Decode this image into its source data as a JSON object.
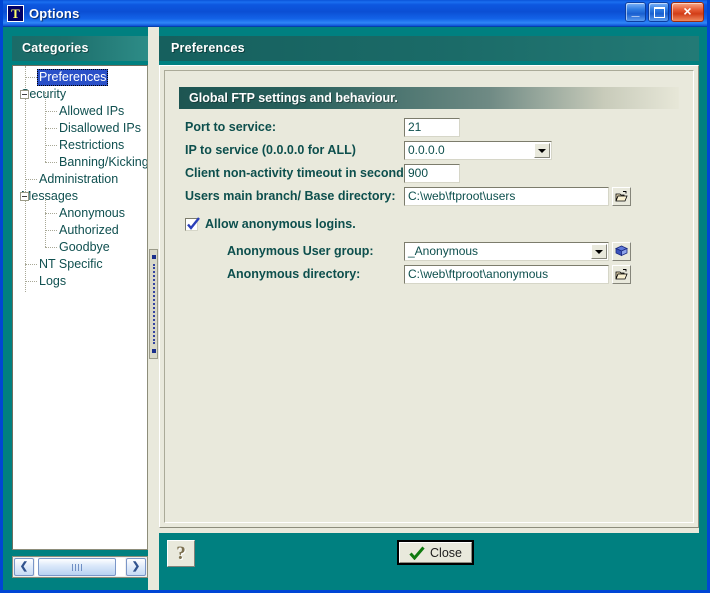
{
  "window": {
    "title": "Options",
    "icon_letter": "T",
    "buttons": {
      "minimize": "_",
      "maximize": "",
      "close": "×"
    }
  },
  "left_panel": {
    "header": "Categories",
    "tree": [
      {
        "label": "Preferences",
        "level": 1,
        "selected": true,
        "expander": false
      },
      {
        "label": "Security",
        "level": 0,
        "selected": false,
        "expander": true
      },
      {
        "label": "Allowed IPs",
        "level": 2,
        "selected": false,
        "expander": false
      },
      {
        "label": "Disallowed IPs",
        "level": 2,
        "selected": false,
        "expander": false
      },
      {
        "label": "Restrictions",
        "level": 2,
        "selected": false,
        "expander": false
      },
      {
        "label": "Banning/Kicking",
        "level": 2,
        "selected": false,
        "expander": false
      },
      {
        "label": "Administration",
        "level": 1,
        "selected": false,
        "expander": false
      },
      {
        "label": "Messages",
        "level": 0,
        "selected": false,
        "expander": true
      },
      {
        "label": "Anonymous",
        "level": 2,
        "selected": false,
        "expander": false
      },
      {
        "label": "Authorized",
        "level": 2,
        "selected": false,
        "expander": false
      },
      {
        "label": "Goodbye",
        "level": 2,
        "selected": false,
        "expander": false
      },
      {
        "label": "NT Specific",
        "level": 1,
        "selected": false,
        "expander": false
      },
      {
        "label": "Logs",
        "level": 1,
        "selected": false,
        "expander": false
      }
    ],
    "hscroll": {
      "left_arrow": "❮",
      "right_arrow": "❯"
    }
  },
  "right_panel": {
    "header": "Preferences",
    "section_title": "Global FTP settings and behaviour.",
    "fields": {
      "port": {
        "label": "Port to service:",
        "value": "21"
      },
      "ip": {
        "label": "IP to service (0.0.0.0 for ALL)",
        "value": "0.0.0.0"
      },
      "timeout": {
        "label": "Client non-activity timeout in seconds:",
        "value": "900"
      },
      "base_dir": {
        "label": "Users main branch/ Base directory:",
        "value": "C:\\web\\ftproot\\users"
      },
      "allow_anonymous": {
        "label": "Allow anonymous logins.",
        "checked": true
      },
      "anon_group": {
        "label": "Anonymous User group:",
        "value": "_Anonymous"
      },
      "anon_dir": {
        "label": "Anonymous directory:",
        "value": "C:\\web\\ftproot\\anonymous"
      }
    },
    "footer": {
      "help_label": "?",
      "close_label": "Close"
    }
  },
  "colors": {
    "desktop_teal": "#008080",
    "panel_beige": "#e9e9dc",
    "title_blue": "#0b4fd4",
    "label_teal": "#0d4f4d",
    "selection_blue": "#2a50c8",
    "accent_green": "#1a8a1a"
  }
}
